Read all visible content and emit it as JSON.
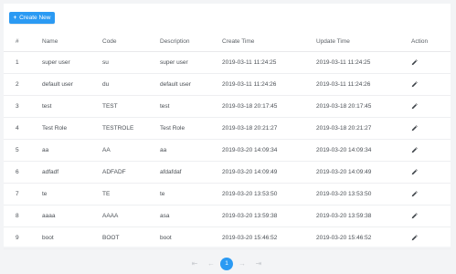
{
  "toolbar": {
    "create_plus": "+",
    "create_label": "Create New"
  },
  "columns": [
    "#",
    "Name",
    "Code",
    "Description",
    "Create Time",
    "Update Time",
    "Action"
  ],
  "rows": [
    {
      "idx": "1",
      "name": "super user",
      "code": "su",
      "desc": "super user",
      "ctime": "2019-03-11 11:24:25",
      "utime": "2019-03-11 11:24:25"
    },
    {
      "idx": "2",
      "name": "default user",
      "code": "du",
      "desc": "default user",
      "ctime": "2019-03-11 11:24:26",
      "utime": "2019-03-11 11:24:26"
    },
    {
      "idx": "3",
      "name": "test",
      "code": "TEST",
      "desc": "test",
      "ctime": "2019-03-18 20:17:45",
      "utime": "2019-03-18 20:17:45"
    },
    {
      "idx": "4",
      "name": "Test Role",
      "code": "TESTROLE",
      "desc": "Test Role",
      "ctime": "2019-03-18 20:21:27",
      "utime": "2019-03-18 20:21:27"
    },
    {
      "idx": "5",
      "name": "aa",
      "code": "AA",
      "desc": "aa",
      "ctime": "2019-03-20 14:09:34",
      "utime": "2019-03-20 14:09:34"
    },
    {
      "idx": "6",
      "name": "adfadf",
      "code": "ADFADF",
      "desc": "afdafdaf",
      "ctime": "2019-03-20 14:09:49",
      "utime": "2019-03-20 14:09:49"
    },
    {
      "idx": "7",
      "name": "te",
      "code": "TE",
      "desc": "te",
      "ctime": "2019-03-20 13:53:50",
      "utime": "2019-03-20 13:53:50"
    },
    {
      "idx": "8",
      "name": "aaaa",
      "code": "AAAA",
      "desc": "asa",
      "ctime": "2019-03-20 13:59:38",
      "utime": "2019-03-20 13:59:38"
    },
    {
      "idx": "9",
      "name": "boot",
      "code": "BOOT",
      "desc": "boot",
      "ctime": "2019-03-20 15:46:52",
      "utime": "2019-03-20 15:46:52"
    }
  ],
  "pagination": {
    "first": "⇤",
    "prev": "←",
    "current": "1",
    "next": "→",
    "last": "⇥"
  },
  "icons": {
    "edit": "pencil-icon"
  },
  "colors": {
    "primary": "#2b9af3"
  }
}
